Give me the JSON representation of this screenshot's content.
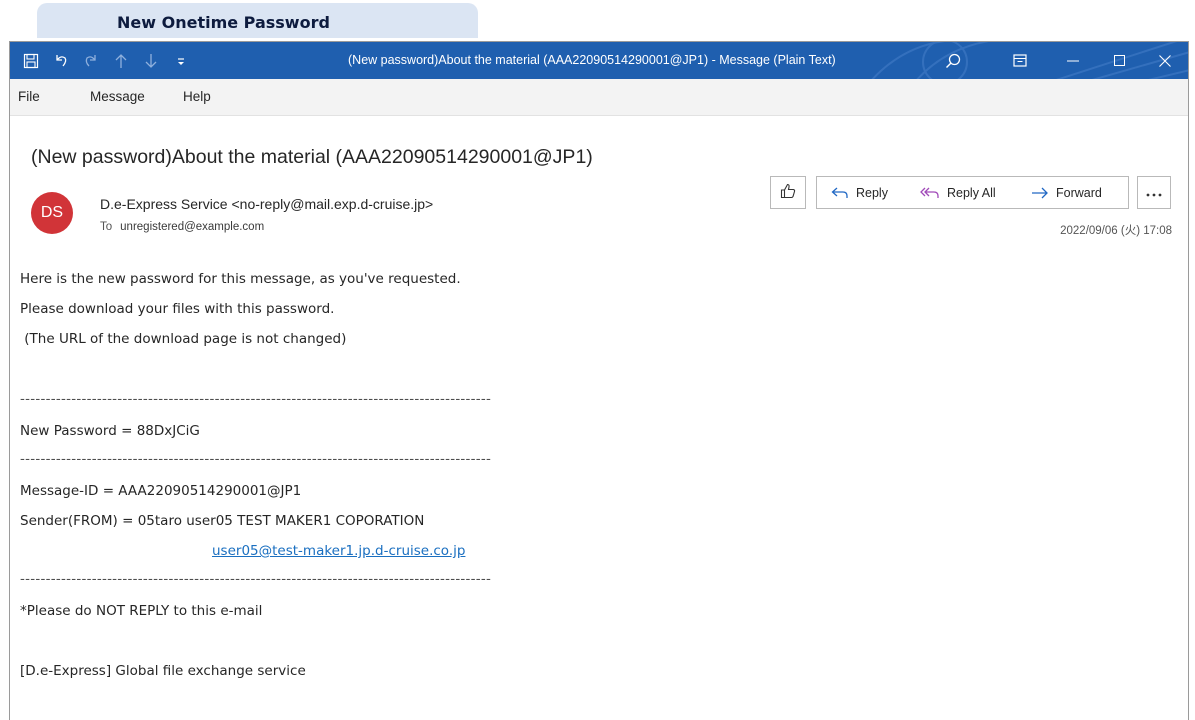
{
  "page_tab": {
    "label": "New Onetime Password"
  },
  "window": {
    "title": "(New password)About the material (AAA22090514290001@JP1)  -  Message (Plain Text)",
    "icons": [
      "save-icon",
      "undo-icon",
      "redo-icon",
      "up-arrow-icon",
      "down-arrow-icon",
      "customize-qat-icon",
      "search-icon",
      "ribbon-display-icon",
      "minimize-icon",
      "maximize-icon",
      "close-icon"
    ]
  },
  "menu": {
    "items": [
      "File",
      "Message",
      "Help"
    ]
  },
  "email": {
    "subject": "(New password)About the material (AAA22090514290001@JP1)",
    "avatar_initials": "DS",
    "avatar_color": "#d13438",
    "sender": "D.e-Express Service <no-reply@mail.exp.d-cruise.jp>",
    "to_label": "To",
    "to": "unregistered@example.com",
    "date": "2022/09/06 (火) 17:08",
    "actions": {
      "reply": "Reply",
      "reply_all": "Reply All",
      "forward": "Forward"
    },
    "body": {
      "line1": "Here is the new password for this message, as you've requested.",
      "line2": "Please download your files with this password.",
      "line3": " (The URL of the download page is not changed)",
      "separator": "--------------------------------------------------------------------------------------------",
      "password_line": "New Password = 88DxJCiG",
      "message_id_line": "Message-ID = AAA22090514290001@JP1",
      "sender_line": "Sender(FROM) = 05taro user05 TEST MAKER1 COPORATION",
      "sender_email": "user05@test-maker1.jp.d-cruise.co.jp",
      "no_reply_line": "*Please do NOT REPLY to this e-mail",
      "footer_line": "[D.e-Express] Global file exchange service"
    }
  },
  "colors": {
    "titlebar": "#1f5faf",
    "link": "#1a6fc0",
    "tab": "#dbe5f3"
  }
}
